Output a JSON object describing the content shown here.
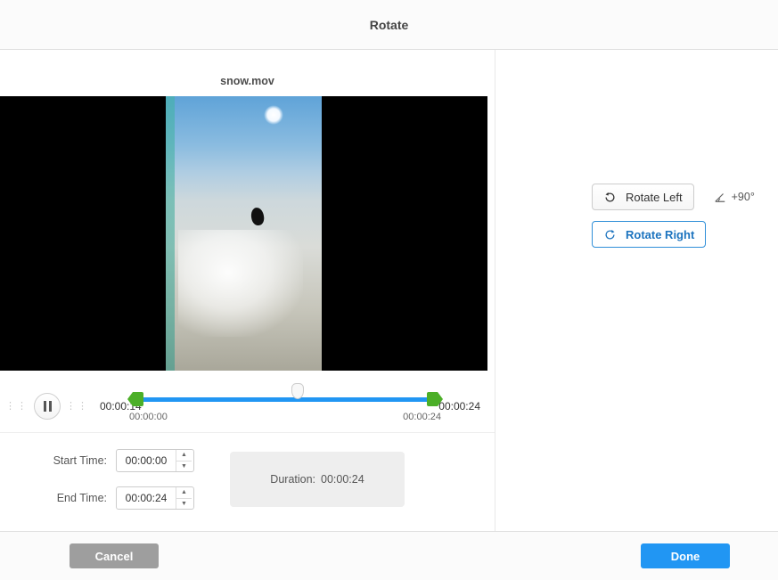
{
  "header": {
    "title": "Rotate"
  },
  "file": {
    "name": "snow.mov"
  },
  "timeline": {
    "current_time": "00:00:14",
    "end_time_display": "00:00:24",
    "range_start": "00:00:00",
    "range_end": "00:00:24"
  },
  "trim": {
    "start_label": "Start Time:",
    "start_value": "00:00:00",
    "end_label": "End Time:",
    "end_value": "00:00:24",
    "duration_label": "Duration:",
    "duration_value": "00:00:24"
  },
  "rotate": {
    "left_label": "Rotate Left",
    "right_label": "Rotate Right",
    "angle_text": "+90°"
  },
  "footer": {
    "cancel": "Cancel",
    "done": "Done"
  }
}
